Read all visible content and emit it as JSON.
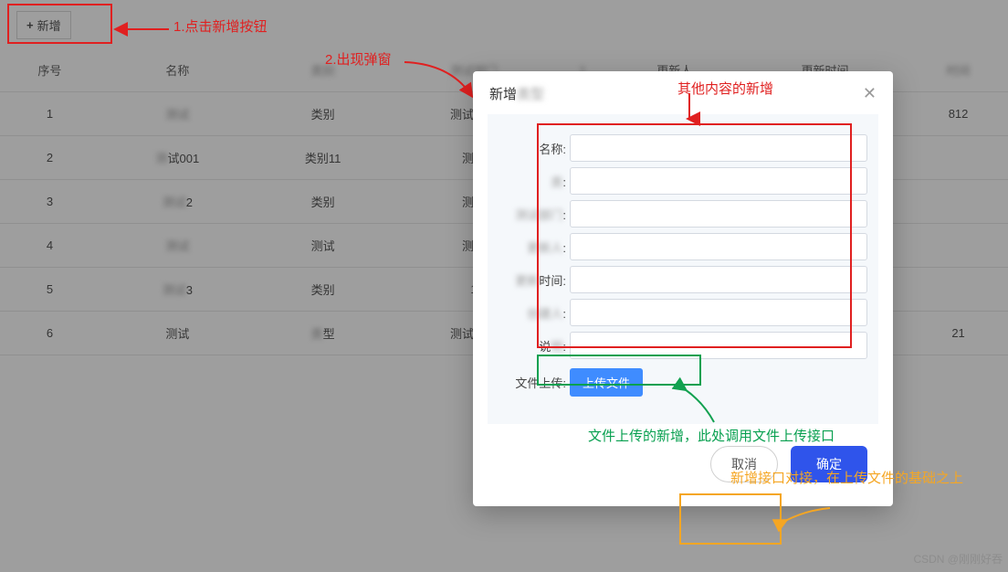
{
  "toolbar": {
    "add_label": "新增"
  },
  "table": {
    "headers": [
      "序号",
      "名称",
      "",
      "",
      "",
      "更新人",
      "更新时间",
      ""
    ],
    "header_blur2": "类别",
    "header_blur3": "测试部门",
    "header_blur4": "1",
    "header_blur7": "时间",
    "rows": [
      {
        "idx": "1",
        "name": "",
        "name_blur": "测试",
        "type": "类别",
        "dept": "测试部门",
        "col5": "",
        "col5_blur": "",
        "updater": "",
        "time": "",
        "time_suffix": "812"
      },
      {
        "idx": "2",
        "name": "试001",
        "name_blur": "测",
        "type": "类别11",
        "dept": "测试",
        "col5": "",
        "col5_blur": "",
        "updater": "",
        "time": "",
        "time_suffix": ""
      },
      {
        "idx": "3",
        "name": "2",
        "name_blur": "测试",
        "type": "类别",
        "dept": "测试",
        "col5": "",
        "col5_blur": "",
        "updater": "",
        "time": "",
        "time_suffix": ""
      },
      {
        "idx": "4",
        "name": "",
        "name_blur": "测试",
        "type": "测试",
        "dept": "测试",
        "col5": "",
        "col5_blur": "",
        "updater": "",
        "time": "",
        "time_suffix": ""
      },
      {
        "idx": "5",
        "name": "3",
        "name_blur": "测试",
        "type": "类别",
        "dept": "1",
        "col5": "",
        "col5_blur": "",
        "updater": "",
        "time": "",
        "time_suffix": ""
      },
      {
        "idx": "6",
        "name": "测试",
        "name_blur": "",
        "type": "型",
        "type_blur": "类",
        "dept": "测试属性",
        "col5": "",
        "col5_blur": "",
        "updater": "",
        "time": "",
        "time_suffix": "21"
      }
    ]
  },
  "modal": {
    "title": "新增",
    "title_blur": "类型",
    "fields": {
      "f1": "名称:",
      "f2_blur": "类",
      "f2_suffix": ":",
      "f3_blur": "测试部门",
      "f3_suffix": ":",
      "f4_blur": "更新人",
      "f4_suffix": ":",
      "f5_prefix_blur": "更新",
      "f5_mid": "时间:",
      "f6_blur": "创建人",
      "f6_suffix": ":",
      "f7_prefix": "说",
      "f7_blur": "明",
      "f7_suffix": ":",
      "upload_label": "文件上传:",
      "upload_btn": "上传文件"
    },
    "cancel": "取消",
    "ok": "确定"
  },
  "annotations": {
    "a1": "1.点击新增按钮",
    "a2": "2.出现弹窗",
    "a3": "其他内容的新增",
    "a4": "文件上传的新增，此处调用文件上传接口",
    "a5": "新增接口对接，在上传文件的基础之上"
  },
  "watermark": "CSDN @刚刚好吞"
}
